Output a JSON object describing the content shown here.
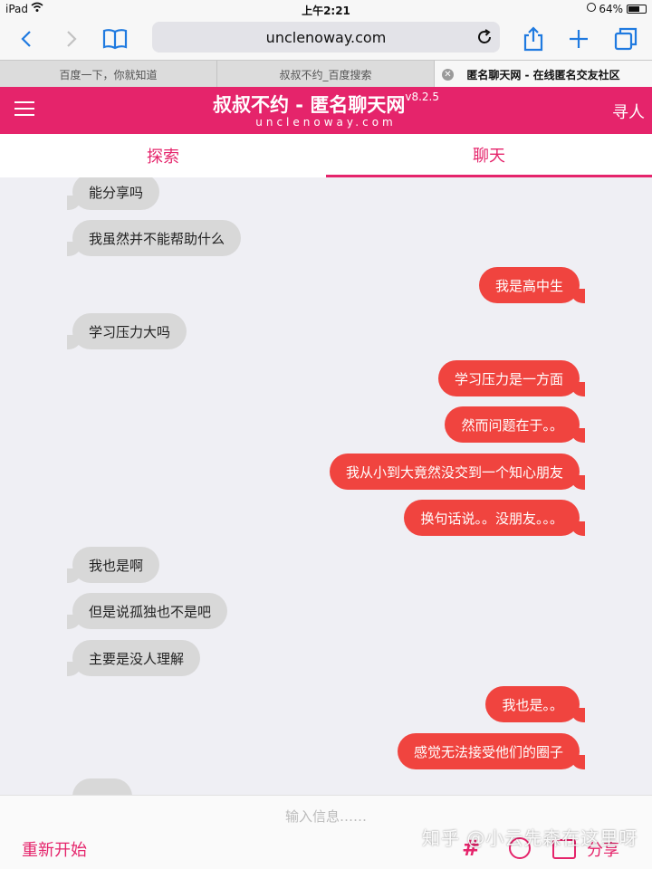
{
  "status_bar": {
    "device": "iPad",
    "time": "上午2:21",
    "battery_pct": "64%",
    "battery_level": 0.64
  },
  "browser": {
    "url": "unclenoway.com",
    "tabs": [
      {
        "label": "百度一下，你就知道"
      },
      {
        "label": "叔叔不约_百度搜索"
      },
      {
        "label": "匿名聊天网 - 在线匿名交友社区",
        "active": true
      }
    ]
  },
  "site": {
    "title": "叔叔不约 - 匿名聊天网",
    "version": "v8.2.5",
    "subtitle": "unclenoway.com",
    "find_label": "寻人",
    "page_tabs": [
      {
        "label": "探索"
      },
      {
        "label": "聊天",
        "active": true
      }
    ]
  },
  "messages": [
    {
      "side": "left",
      "text": "能分享吗"
    },
    {
      "side": "left",
      "text": "我虽然并不能帮助什么"
    },
    {
      "side": "right",
      "text": "我是高中生"
    },
    {
      "side": "left",
      "text": "学习压力大吗"
    },
    {
      "side": "right",
      "text": "学习压力是一方面"
    },
    {
      "side": "right",
      "text": "然而问题在于。。"
    },
    {
      "side": "right",
      "text": "我从小到大竟然没交到一个知心朋友"
    },
    {
      "side": "right",
      "text": "换句话说。。没朋友。。。"
    },
    {
      "side": "left",
      "text": "我也是啊"
    },
    {
      "side": "left",
      "text": "但是说孤独也不是吧"
    },
    {
      "side": "left",
      "text": "主要是没人理解"
    },
    {
      "side": "right",
      "text": "我也是。。"
    },
    {
      "side": "right",
      "text": "感觉无法接受他们的圈子"
    }
  ],
  "input": {
    "placeholder": "输入信息……",
    "restart_label": "重新开始",
    "share_label": "分享"
  },
  "watermark": "知乎 @小云先森在这里呀",
  "colors": {
    "brand": "#e5246b",
    "my_bubble": "#f0443f",
    "other_bubble": "#d8d8d8"
  }
}
